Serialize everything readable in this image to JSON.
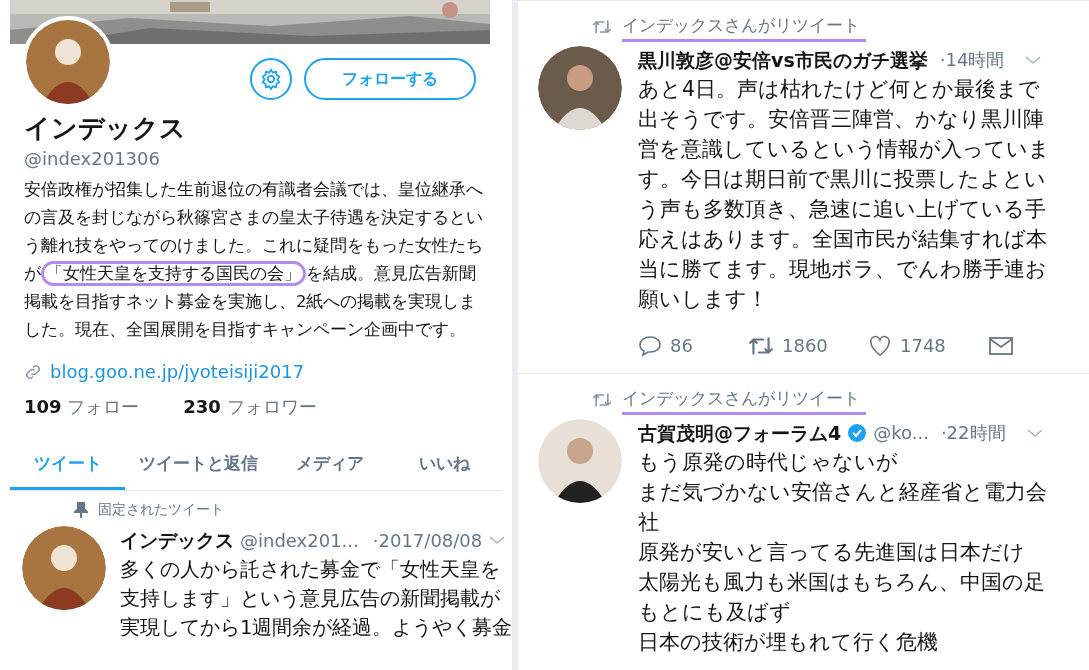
{
  "profile": {
    "follow_button": "フォローする",
    "name": "インデックス",
    "handle": "@index201306",
    "bio": {
      "before": "安倍政権が招集した生前退位の有識者会議では、皇位継承への言及を封じながら秋篠宮さまの皇太子待遇を決定するという離れ技をやってのけました。これに疑問をもった女性たちが",
      "highlighted": "「女性天皇を支持する国民の会」",
      "after": "を結成。意見広告新聞掲載を目指すネット募金を実施し、2紙への掲載を実現しました。現在、全国展開を目指すキャンペーン企画中です。"
    },
    "link": "blog.goo.ne.jp/jyoteisiji2017",
    "following": {
      "count": "109",
      "label": "フォロー"
    },
    "followers": {
      "count": "230",
      "label": "フォロワー"
    }
  },
  "tabs": [
    {
      "label": "ツイート",
      "selected": true
    },
    {
      "label": "ツイートと返信",
      "selected": false
    },
    {
      "label": "メディア",
      "selected": false
    },
    {
      "label": "いいね",
      "selected": false
    }
  ],
  "pinned_tweet": {
    "pin_label": "固定されたツイート",
    "name": "インデックス",
    "handle": "@index201...",
    "time": "·2017/08/08",
    "lines": [
      "多くの人から託された募金で「女性天皇を",
      "支持します」という意見広告の新聞掲載が",
      "実現してから1週間余が経過。ようやく募金"
    ]
  },
  "timeline": [
    {
      "retweet_label": "インデックスさんがリツイート",
      "name": "黒川敦彦@安倍vs市民のガチ選挙",
      "verified": false,
      "time": "·14時間",
      "lines": [
        "あと4日。声は枯れたけど何とか最後まで",
        "出そうです。安倍晋三陣営、かなり黒川陣",
        "営を意識しているという情報が入っていま",
        "す。今日は期日前で黒川に投票したよとい",
        "う声も多数頂き、急速に追い上げている手",
        "応えはあります。全国市民が結集すれば本",
        "当に勝てます。現地ボラ、でんわ勝手連お",
        "願いします！"
      ],
      "replies": "86",
      "retweets": "1860",
      "likes": "1748"
    },
    {
      "retweet_label": "インデックスさんがリツイート",
      "name": "古賀茂明@フォーラム4",
      "verified": true,
      "handle": "@ko...",
      "time": "·22時間",
      "lines": [
        "もう原発の時代じゃないが",
        "まだ気づかない安倍さんと経産省と電力会",
        "社",
        "原発が安いと言ってる先進国は日本だけ",
        "太陽光も風力も米国はもちろん、中国の足",
        "もとにも及ばず",
        "日本の技術が埋もれて行く危機"
      ]
    }
  ]
}
